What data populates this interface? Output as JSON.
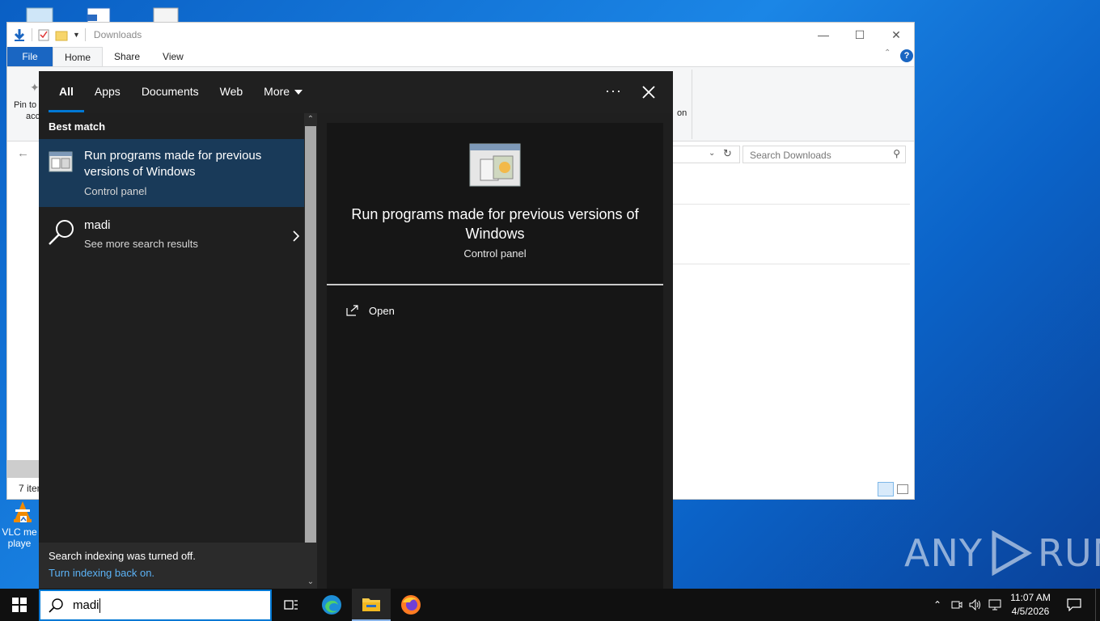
{
  "explorer": {
    "title": "Downloads",
    "tabs": [
      "File",
      "Home",
      "Share",
      "View"
    ],
    "ribbon_partial_label_1": "Pin to",
    "ribbon_partial_label_2": "acc",
    "ribbon_partial_label_3": "on",
    "search_placeholder": "Search Downloads",
    "status_text": "7 iten"
  },
  "desktop": {
    "vlc_label_1": "VLC me",
    "vlc_label_2": "playe"
  },
  "search": {
    "tabs": [
      "All",
      "Apps",
      "Documents",
      "Web",
      "More"
    ],
    "more_options": "···",
    "section_title": "Best match",
    "best_match": {
      "title": "Run programs made for previous versions of Windows",
      "subtitle": "Control panel"
    },
    "web_result": {
      "title": "madi",
      "subtitle": "See more search results"
    },
    "footer_text": "Search indexing was turned off.",
    "footer_link": "Turn indexing back on.",
    "detail": {
      "title": "Run programs made for previous versions of Windows",
      "subtitle": "Control panel",
      "action_open": "Open"
    }
  },
  "taskbar": {
    "search_value": "madi",
    "time": "11:07 AM",
    "date": "4/5/2026"
  },
  "watermark": {
    "left": "ANY",
    "right": "RUN"
  },
  "colors": {
    "accent": "#0078d4",
    "selected_result": "#193a59",
    "link": "#5bb2f5"
  }
}
